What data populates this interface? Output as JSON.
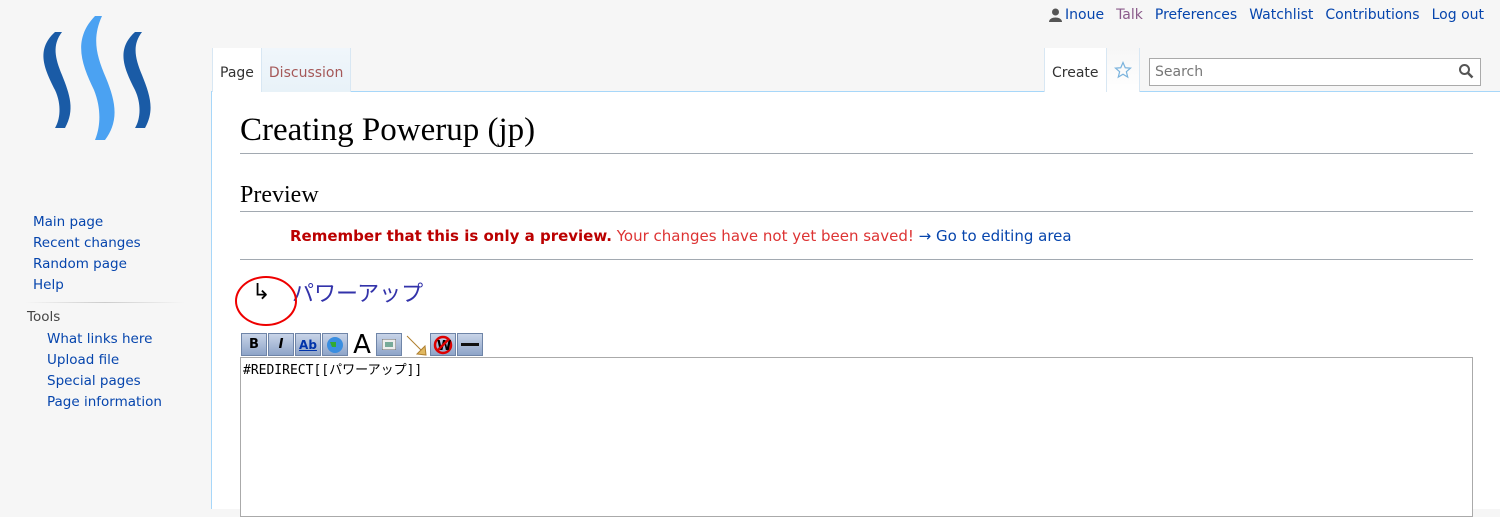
{
  "personal": {
    "user": "Inoue",
    "talk": "Talk",
    "preferences": "Preferences",
    "watchlist": "Watchlist",
    "contributions": "Contributions",
    "logout": "Log out"
  },
  "tabs": {
    "page": "Page",
    "discussion": "Discussion",
    "create": "Create"
  },
  "search": {
    "placeholder": "Search"
  },
  "nav": [
    "Main page",
    "Recent changes",
    "Random page",
    "Help"
  ],
  "tools": {
    "heading": "Tools",
    "items": [
      "What links here",
      "Upload file",
      "Special pages",
      "Page information"
    ]
  },
  "page": {
    "title": "Creating Powerup (jp)",
    "preview_heading": "Preview",
    "warning_bold": "Remember that this is only a preview.",
    "warning_rest": "Your changes have not yet been saved!",
    "goto": "→ Go to editing area",
    "redirect_arrow": "↳",
    "redirect_target": "パワーアップ"
  },
  "editor": {
    "content": "#REDIRECT[[パワーアップ]]",
    "buttons": {
      "bold": "B",
      "italic": "I",
      "link": "Ab",
      "big": "A"
    }
  },
  "colors": {
    "link": "#0645ad",
    "warning": "#dd3333",
    "logo_dark": "#1a5ba6",
    "logo_light": "#4ba2f2"
  }
}
